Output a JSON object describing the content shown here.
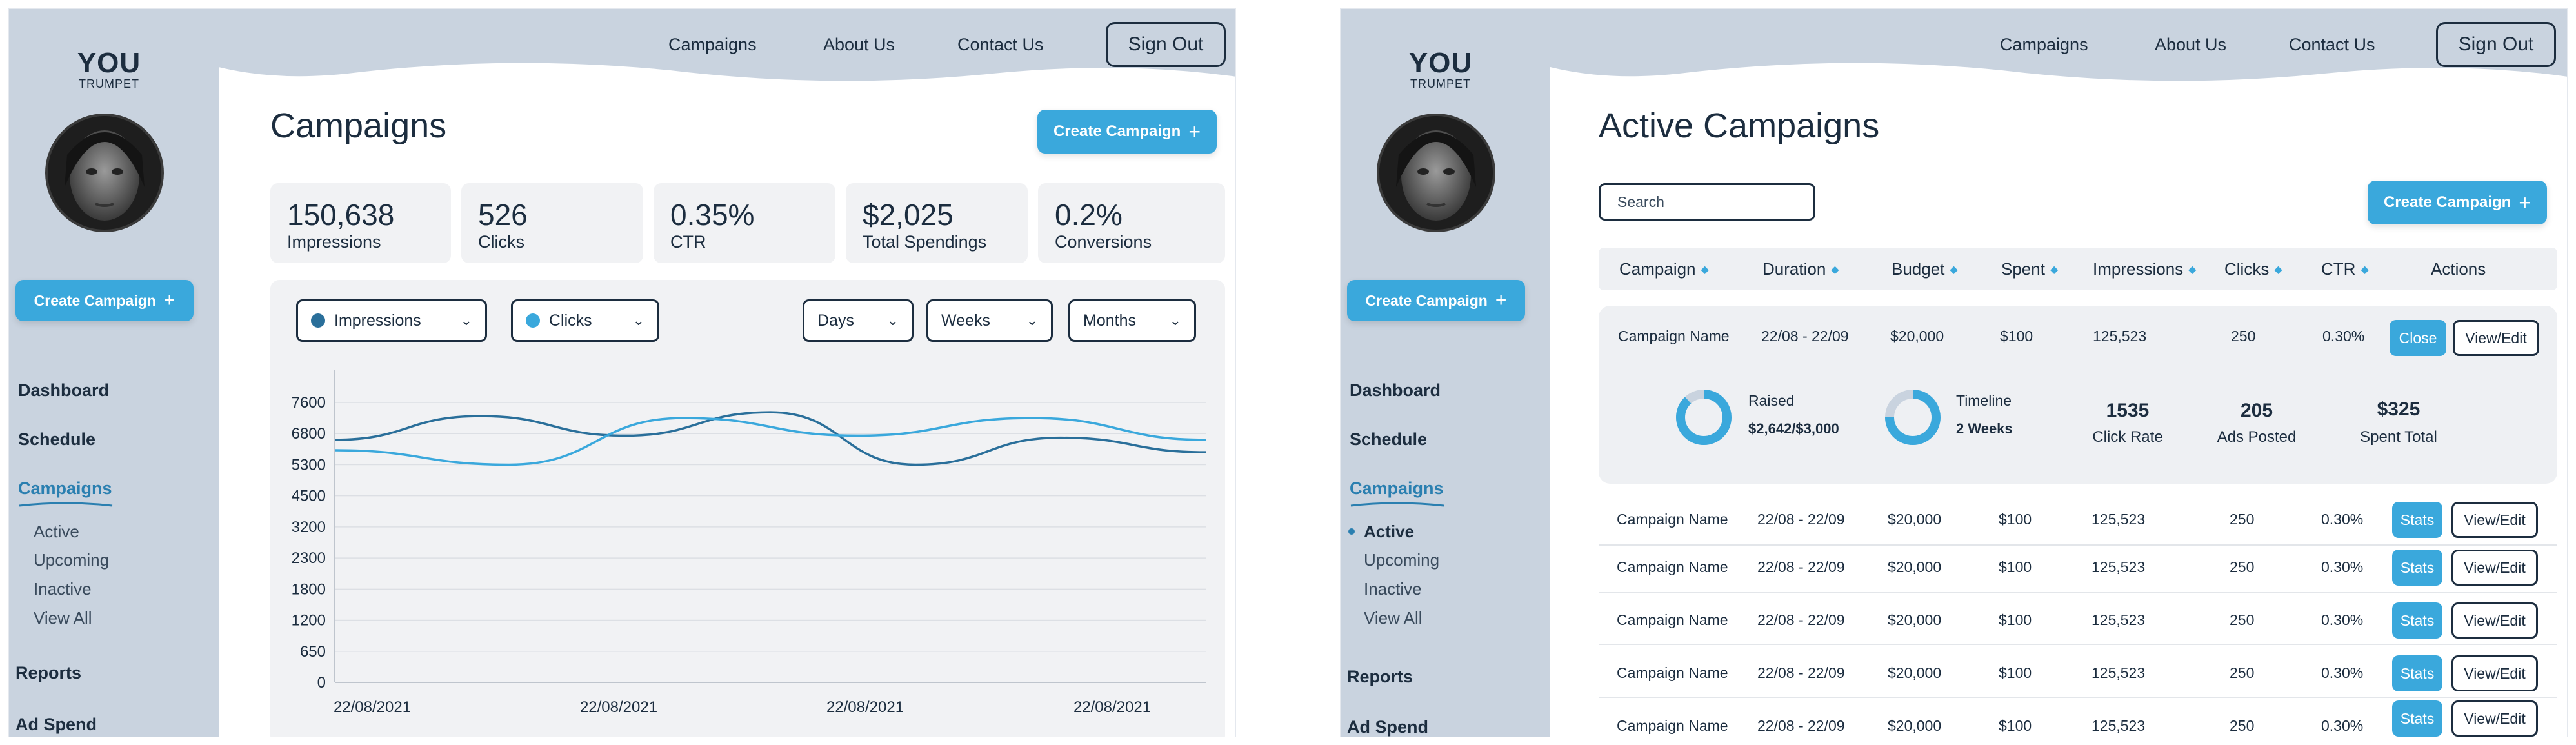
{
  "brand": {
    "logo_main": "YOU",
    "logo_sub": "TRUMPET"
  },
  "header": {
    "nav": [
      "Campaigns",
      "About Us",
      "Contact Us"
    ],
    "sign_out": "Sign Out"
  },
  "sidebar": {
    "create_label": "Create Campaign",
    "plus": "+",
    "items": {
      "dashboard": "Dashboard",
      "schedule": "Schedule",
      "campaigns": "Campaigns",
      "reports": "Reports",
      "ad_spend": "Ad Spend"
    },
    "sub_items": [
      "Active",
      "Upcoming",
      "Inactive",
      "View All"
    ]
  },
  "screen1": {
    "title": "Campaigns",
    "create_label": "Create Campaign",
    "stats": [
      {
        "value": "150,638",
        "label": "Impressions"
      },
      {
        "value": "526",
        "label": "Clicks"
      },
      {
        "value": "0.35%",
        "label": "CTR"
      },
      {
        "value": "$2,025",
        "label": "Total Spendings"
      },
      {
        "value": "0.2%",
        "label": "Conversions"
      }
    ],
    "filters": {
      "series": [
        "Impressions",
        "Clicks"
      ],
      "periods": [
        "Days",
        "Weeks",
        "Months"
      ]
    },
    "colors": {
      "impressions": "#2a6f9a",
      "clicks": "#3aa8dc"
    }
  },
  "chart_data": {
    "type": "line",
    "y_ticks": [
      0,
      650,
      1200,
      1800,
      2300,
      3200,
      4500,
      5300,
      6800,
      7600
    ],
    "x_ticks": [
      "22/08/2021",
      "22/08/2021",
      "22/08/2021",
      "22/08/2021"
    ],
    "series": [
      {
        "name": "Impressions",
        "values": [
          6500,
          7250,
          6700,
          7350,
          5300,
          6600,
          5900
        ]
      },
      {
        "name": "Clicks",
        "values": [
          6000,
          5300,
          7200,
          6700,
          7200,
          6500
        ]
      }
    ]
  },
  "screen2": {
    "title": "Active Campaigns",
    "create_label": "Create Campaign",
    "search_placeholder": "Search",
    "columns": [
      "Campaign",
      "Duration",
      "Budget",
      "Spent",
      "Impressions",
      "Clicks",
      "CTR",
      "Actions"
    ],
    "expanded": {
      "name": "Campaign Name",
      "duration": "22/08 - 22/09",
      "budget": "$20,000",
      "spent": "$100",
      "impressions": "125,523",
      "clicks": "250",
      "ctr": "0.30%",
      "close": "Close",
      "view_edit": "View/Edit",
      "raised_label": "Raised",
      "raised_value": "$2,642/$3,000",
      "raised_fraction": 0.88,
      "timeline_label": "Timeline",
      "timeline_value": "2 Weeks",
      "timeline_fraction": 0.75,
      "metrics": [
        {
          "value": "1535",
          "label": "Click Rate"
        },
        {
          "value": "205",
          "label": "Ads Posted"
        },
        {
          "value": "$325",
          "label": "Spent Total"
        }
      ]
    },
    "rows": [
      {
        "name": "Campaign Name",
        "duration": "22/08 - 22/09",
        "budget": "$20,000",
        "spent": "$100",
        "impressions": "125,523",
        "clicks": "250",
        "ctr": "0.30%",
        "stats": "Stats",
        "view_edit": "View/Edit"
      },
      {
        "name": "Campaign Name",
        "duration": "22/08 - 22/09",
        "budget": "$20,000",
        "spent": "$100",
        "impressions": "125,523",
        "clicks": "250",
        "ctr": "0.30%",
        "stats": "Stats",
        "view_edit": "View/Edit"
      },
      {
        "name": "Campaign Name",
        "duration": "22/08 - 22/09",
        "budget": "$20,000",
        "spent": "$100",
        "impressions": "125,523",
        "clicks": "250",
        "ctr": "0.30%",
        "stats": "Stats",
        "view_edit": "View/Edit"
      },
      {
        "name": "Campaign Name",
        "duration": "22/08 - 22/09",
        "budget": "$20,000",
        "spent": "$100",
        "impressions": "125,523",
        "clicks": "250",
        "ctr": "0.30%",
        "stats": "Stats",
        "view_edit": "View/Edit"
      },
      {
        "name": "Campaign Name",
        "duration": "22/08 - 22/09",
        "budget": "$20,000",
        "spent": "$100",
        "impressions": "125,523",
        "clicks": "250",
        "ctr": "0.30%",
        "stats": "Stats",
        "view_edit": "View/Edit"
      }
    ]
  }
}
